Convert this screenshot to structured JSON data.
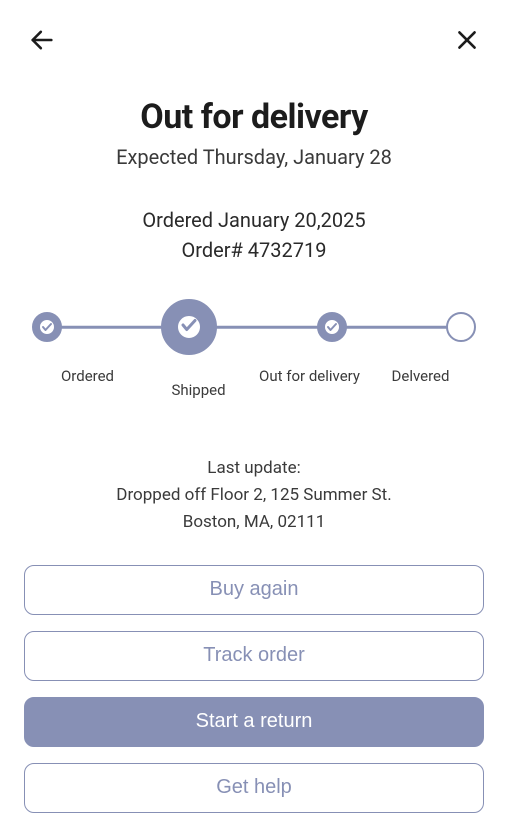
{
  "header": {
    "title": "Out for delivery",
    "expected": "Expected Thursday, January 28"
  },
  "order": {
    "ordered_date": "Ordered January 20,2025",
    "order_number": "Order# 4732719"
  },
  "progress": {
    "steps": [
      {
        "label": "Ordered"
      },
      {
        "label": "Shipped"
      },
      {
        "label": "Out for delivery"
      },
      {
        "label": "Delvered"
      }
    ]
  },
  "update": {
    "heading": "Last update:",
    "line1": "Dropped off Floor 2, 125 Summer St.",
    "line2": "Boston, MA, 02111"
  },
  "actions": {
    "buy_again": "Buy again",
    "track_order": "Track order",
    "start_return": "Start a return",
    "get_help": "Get help"
  }
}
